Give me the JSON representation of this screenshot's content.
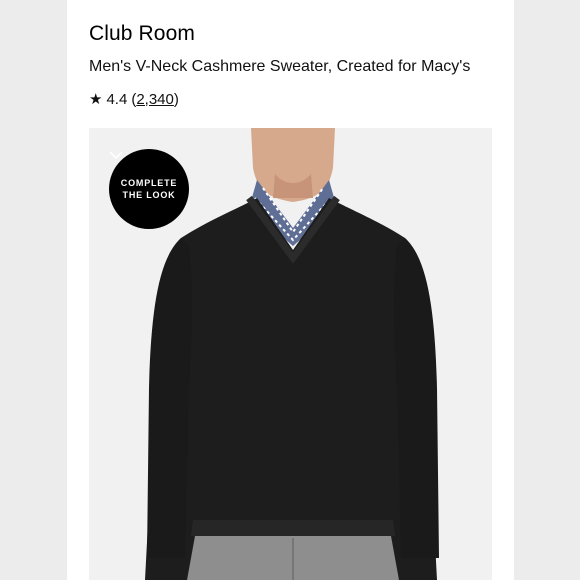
{
  "product": {
    "brand": "Club Room",
    "name": "Men's V-Neck Cashmere Sweater, Created for Macy's",
    "rating": {
      "star": "★",
      "value": "4.4",
      "open_paren": "(",
      "count": "2,340",
      "close_paren": ")"
    }
  },
  "image": {
    "complete_the_look": {
      "line1": "COMPLETE",
      "line2": "THE LOOK"
    }
  },
  "colors": {
    "sweater": "#1d1d1d",
    "background": "#ececec",
    "card": "#ffffff"
  }
}
